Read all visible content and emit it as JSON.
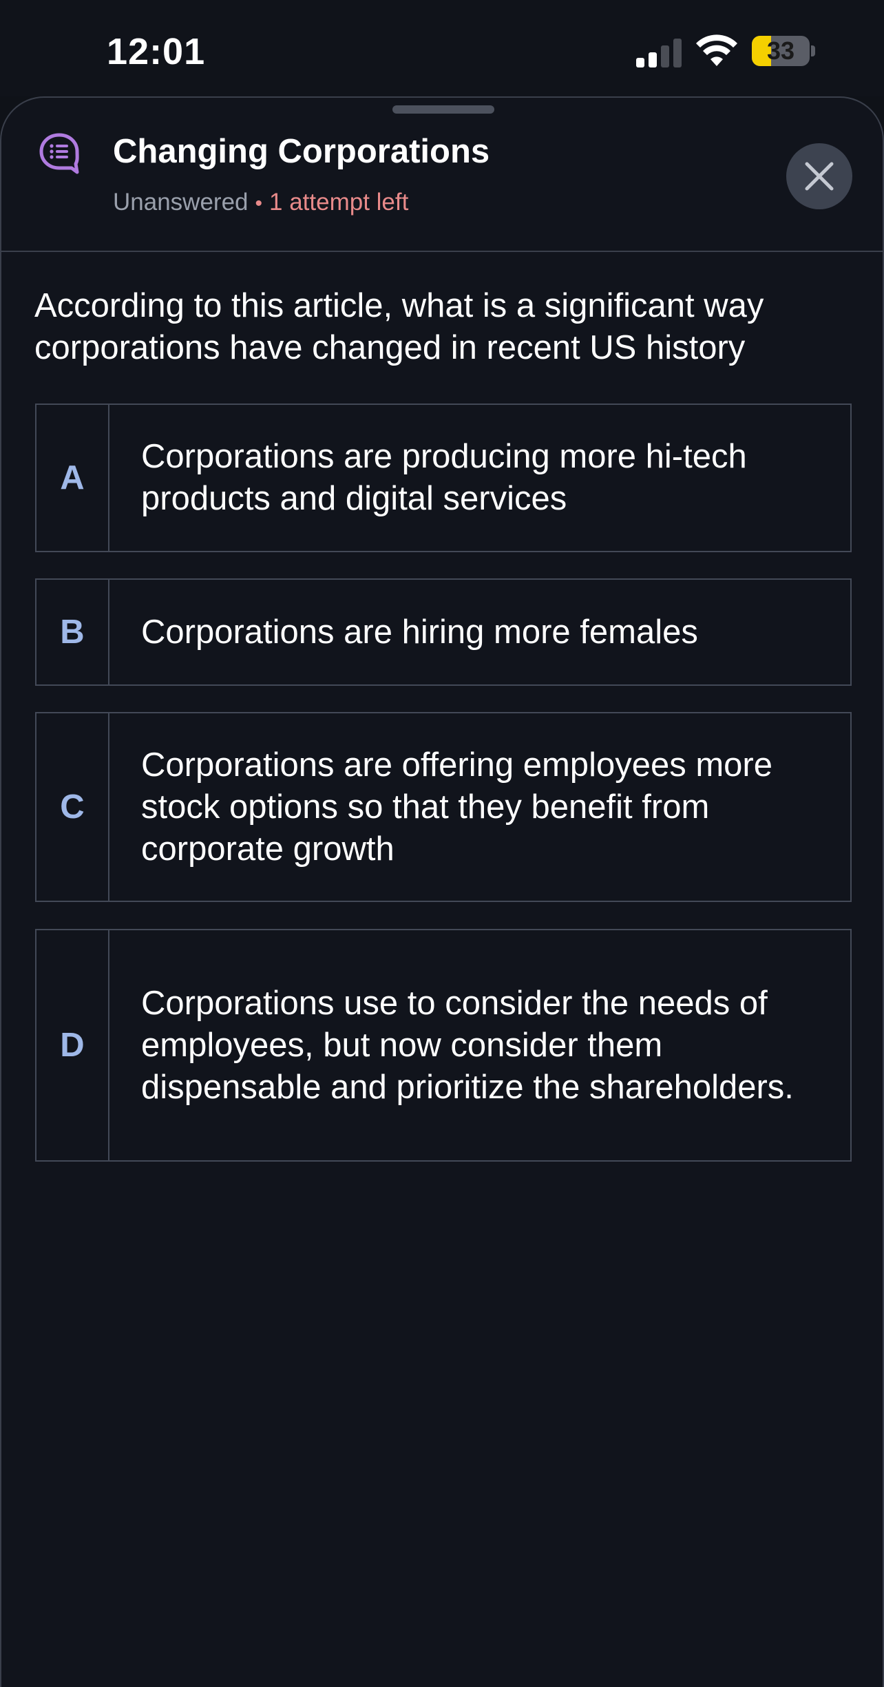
{
  "status_bar": {
    "time": "12:01",
    "battery_level": "33",
    "battery_fraction": 0.33,
    "signal_bars_active": 2,
    "signal_bars_total": 4,
    "battery_color": "#f5d000"
  },
  "sheet": {
    "title": "Changing Corporations",
    "status": "Unanswered",
    "separator": "•",
    "attempts": "1 attempt left",
    "header_icon": "chat-list-icon",
    "close_icon": "close-icon",
    "accent_color": "#b07be0",
    "attempts_color": "#e88a8a"
  },
  "question": {
    "text": "According to this article, what is a significant way corporations have changed in recent US history"
  },
  "options": [
    {
      "letter": "A",
      "text": "Corporations are producing more hi-tech products and digital services"
    },
    {
      "letter": "B",
      "text": "Corporations are hiring more females"
    },
    {
      "letter": "C",
      "text": "Corporations are offering employees more stock options so that they benefit from corporate growth"
    },
    {
      "letter": "D",
      "text": "Corporations use to consider the needs of employees, but now consider them dispensable and prioritize the shareholders."
    }
  ]
}
